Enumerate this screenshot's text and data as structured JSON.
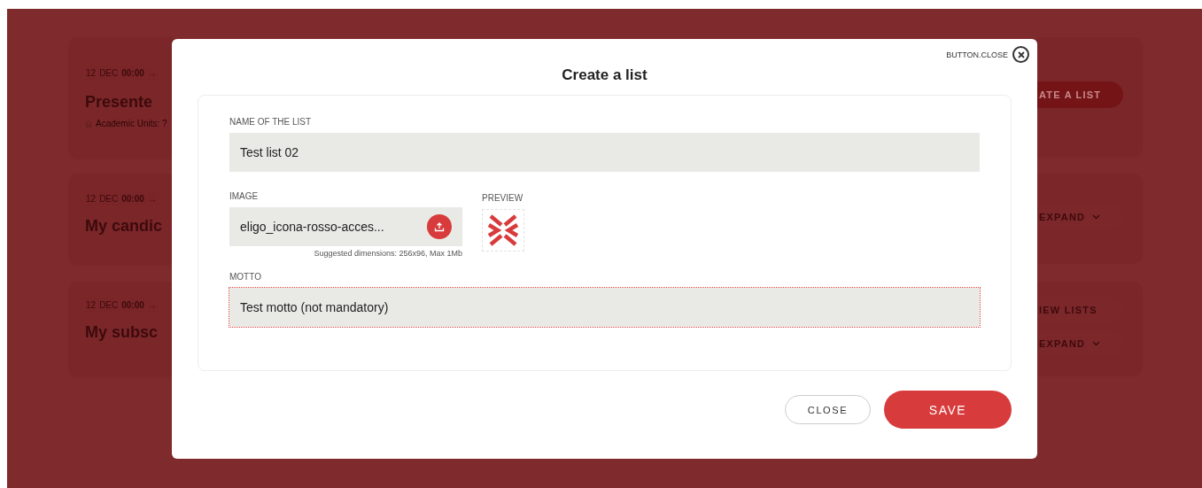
{
  "background_page": {
    "cards": [
      {
        "date": {
          "day": "12",
          "month": "DEC",
          "time": "00:00",
          "arrow": "→"
        },
        "title": "Presente",
        "meta": "Academic Units: ?",
        "actions": [
          {
            "kind": "primary",
            "label": "ATE A LIST"
          }
        ]
      },
      {
        "date": {
          "day": "12",
          "month": "DEC",
          "time": "00:00",
          "arrow": "→"
        },
        "title": "My candic",
        "actions": [
          {
            "kind": "expand",
            "label": "EXPAND"
          }
        ]
      },
      {
        "date": {
          "day": "12",
          "month": "DEC",
          "time": "00:00",
          "arrow": "→"
        },
        "title": "My subsc",
        "actions": [
          {
            "kind": "secondary",
            "label": "IEW LISTS"
          },
          {
            "kind": "expand",
            "label": "EXPAND"
          }
        ]
      }
    ]
  },
  "modal": {
    "close_label": "BUTTON.CLOSE",
    "title": "Create a list",
    "fields": [
      {
        "kind": "text",
        "label": "NAME OF THE LIST",
        "value": "Test list 02",
        "focused": false
      },
      {
        "kind": "file",
        "label": "IMAGE",
        "value": "eligo_icona-rosso-acces...",
        "hint": "Suggested dimensions: 256x96, Max 1Mb",
        "preview_label": "PREVIEW"
      },
      {
        "kind": "text",
        "label": "MOTTO",
        "value": "Test motto (not mandatory)",
        "focused": true
      }
    ],
    "buttons": [
      {
        "kind": "secondary",
        "label": "CLOSE"
      },
      {
        "kind": "primary",
        "label": "SAVE"
      }
    ]
  }
}
